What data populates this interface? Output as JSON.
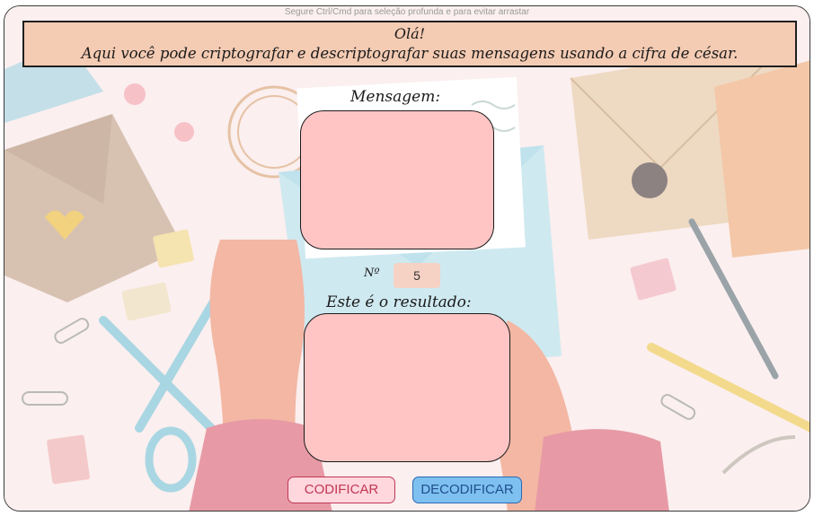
{
  "hint": "Segure Ctrl/Cmd para seleção profunda e para evitar arrastar",
  "banner": {
    "greeting": "Olá!",
    "description": "Aqui você pode criptografar e descriptografar suas mensagens usando a cifra de césar."
  },
  "message": {
    "label": "Mensagem:",
    "value": ""
  },
  "shift": {
    "label": "Nº",
    "value": "5"
  },
  "result": {
    "label": "Este é o resultado:",
    "value": ""
  },
  "buttons": {
    "encode": "CODIFICAR",
    "decode": "DECODIFICAR"
  },
  "colors": {
    "banner_bg": "#f4cbb3",
    "textbox_bg": "#ffc5c5",
    "encode_accent": "#c03656",
    "decode_bg": "#7ec0ef"
  }
}
